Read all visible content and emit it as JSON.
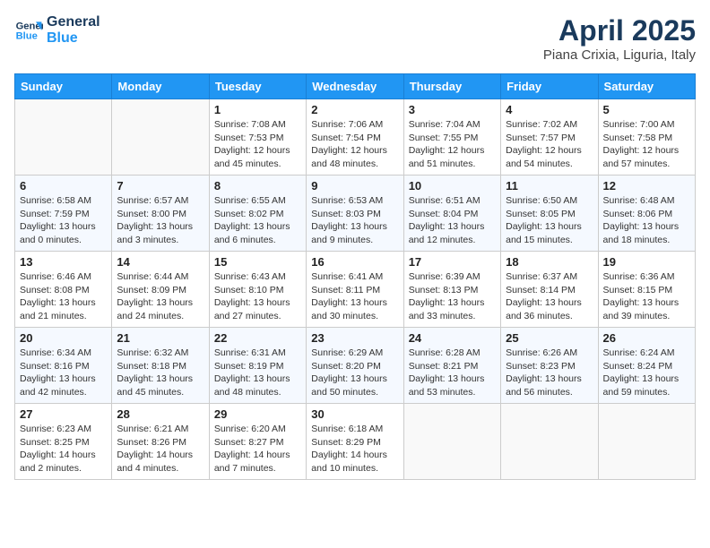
{
  "header": {
    "logo_line1": "General",
    "logo_line2": "Blue",
    "month": "April 2025",
    "location": "Piana Crixia, Liguria, Italy"
  },
  "days_of_week": [
    "Sunday",
    "Monday",
    "Tuesday",
    "Wednesday",
    "Thursday",
    "Friday",
    "Saturday"
  ],
  "weeks": [
    [
      {
        "day": "",
        "info": ""
      },
      {
        "day": "",
        "info": ""
      },
      {
        "day": "1",
        "info": "Sunrise: 7:08 AM\nSunset: 7:53 PM\nDaylight: 12 hours\nand 45 minutes."
      },
      {
        "day": "2",
        "info": "Sunrise: 7:06 AM\nSunset: 7:54 PM\nDaylight: 12 hours\nand 48 minutes."
      },
      {
        "day": "3",
        "info": "Sunrise: 7:04 AM\nSunset: 7:55 PM\nDaylight: 12 hours\nand 51 minutes."
      },
      {
        "day": "4",
        "info": "Sunrise: 7:02 AM\nSunset: 7:57 PM\nDaylight: 12 hours\nand 54 minutes."
      },
      {
        "day": "5",
        "info": "Sunrise: 7:00 AM\nSunset: 7:58 PM\nDaylight: 12 hours\nand 57 minutes."
      }
    ],
    [
      {
        "day": "6",
        "info": "Sunrise: 6:58 AM\nSunset: 7:59 PM\nDaylight: 13 hours\nand 0 minutes."
      },
      {
        "day": "7",
        "info": "Sunrise: 6:57 AM\nSunset: 8:00 PM\nDaylight: 13 hours\nand 3 minutes."
      },
      {
        "day": "8",
        "info": "Sunrise: 6:55 AM\nSunset: 8:02 PM\nDaylight: 13 hours\nand 6 minutes."
      },
      {
        "day": "9",
        "info": "Sunrise: 6:53 AM\nSunset: 8:03 PM\nDaylight: 13 hours\nand 9 minutes."
      },
      {
        "day": "10",
        "info": "Sunrise: 6:51 AM\nSunset: 8:04 PM\nDaylight: 13 hours\nand 12 minutes."
      },
      {
        "day": "11",
        "info": "Sunrise: 6:50 AM\nSunset: 8:05 PM\nDaylight: 13 hours\nand 15 minutes."
      },
      {
        "day": "12",
        "info": "Sunrise: 6:48 AM\nSunset: 8:06 PM\nDaylight: 13 hours\nand 18 minutes."
      }
    ],
    [
      {
        "day": "13",
        "info": "Sunrise: 6:46 AM\nSunset: 8:08 PM\nDaylight: 13 hours\nand 21 minutes."
      },
      {
        "day": "14",
        "info": "Sunrise: 6:44 AM\nSunset: 8:09 PM\nDaylight: 13 hours\nand 24 minutes."
      },
      {
        "day": "15",
        "info": "Sunrise: 6:43 AM\nSunset: 8:10 PM\nDaylight: 13 hours\nand 27 minutes."
      },
      {
        "day": "16",
        "info": "Sunrise: 6:41 AM\nSunset: 8:11 PM\nDaylight: 13 hours\nand 30 minutes."
      },
      {
        "day": "17",
        "info": "Sunrise: 6:39 AM\nSunset: 8:13 PM\nDaylight: 13 hours\nand 33 minutes."
      },
      {
        "day": "18",
        "info": "Sunrise: 6:37 AM\nSunset: 8:14 PM\nDaylight: 13 hours\nand 36 minutes."
      },
      {
        "day": "19",
        "info": "Sunrise: 6:36 AM\nSunset: 8:15 PM\nDaylight: 13 hours\nand 39 minutes."
      }
    ],
    [
      {
        "day": "20",
        "info": "Sunrise: 6:34 AM\nSunset: 8:16 PM\nDaylight: 13 hours\nand 42 minutes."
      },
      {
        "day": "21",
        "info": "Sunrise: 6:32 AM\nSunset: 8:18 PM\nDaylight: 13 hours\nand 45 minutes."
      },
      {
        "day": "22",
        "info": "Sunrise: 6:31 AM\nSunset: 8:19 PM\nDaylight: 13 hours\nand 48 minutes."
      },
      {
        "day": "23",
        "info": "Sunrise: 6:29 AM\nSunset: 8:20 PM\nDaylight: 13 hours\nand 50 minutes."
      },
      {
        "day": "24",
        "info": "Sunrise: 6:28 AM\nSunset: 8:21 PM\nDaylight: 13 hours\nand 53 minutes."
      },
      {
        "day": "25",
        "info": "Sunrise: 6:26 AM\nSunset: 8:23 PM\nDaylight: 13 hours\nand 56 minutes."
      },
      {
        "day": "26",
        "info": "Sunrise: 6:24 AM\nSunset: 8:24 PM\nDaylight: 13 hours\nand 59 minutes."
      }
    ],
    [
      {
        "day": "27",
        "info": "Sunrise: 6:23 AM\nSunset: 8:25 PM\nDaylight: 14 hours\nand 2 minutes."
      },
      {
        "day": "28",
        "info": "Sunrise: 6:21 AM\nSunset: 8:26 PM\nDaylight: 14 hours\nand 4 minutes."
      },
      {
        "day": "29",
        "info": "Sunrise: 6:20 AM\nSunset: 8:27 PM\nDaylight: 14 hours\nand 7 minutes."
      },
      {
        "day": "30",
        "info": "Sunrise: 6:18 AM\nSunset: 8:29 PM\nDaylight: 14 hours\nand 10 minutes."
      },
      {
        "day": "",
        "info": ""
      },
      {
        "day": "",
        "info": ""
      },
      {
        "day": "",
        "info": ""
      }
    ]
  ]
}
